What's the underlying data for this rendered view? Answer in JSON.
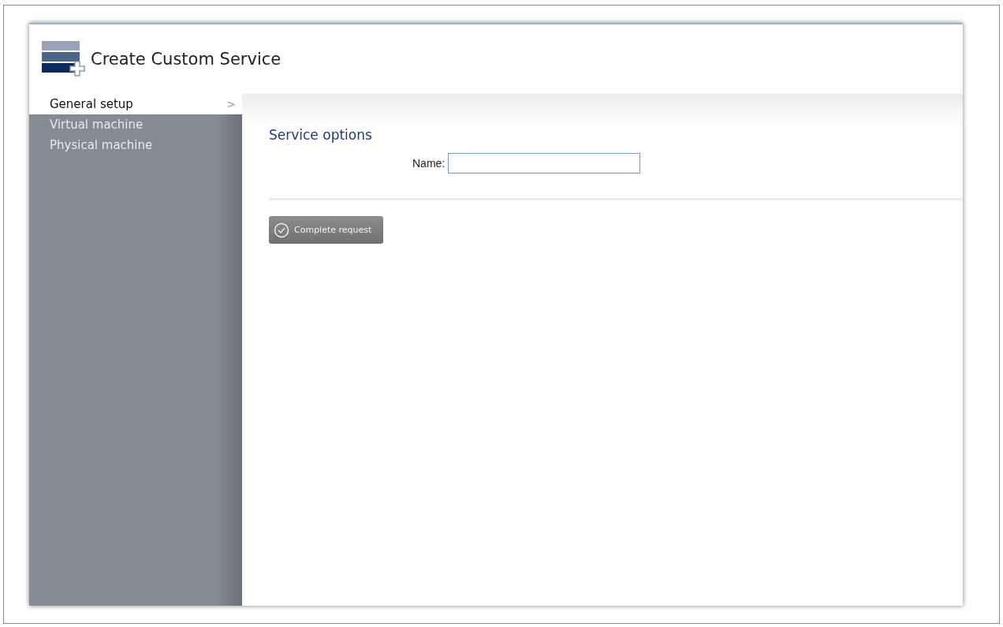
{
  "window": {
    "title": "Create Custom Service"
  },
  "sidebar": {
    "items": [
      {
        "label": "General setup",
        "selected": true,
        "chevron": ">"
      },
      {
        "label": "Virtual machine",
        "selected": false
      },
      {
        "label": "Physical machine",
        "selected": false
      }
    ]
  },
  "section": {
    "title": "Service options",
    "fields": [
      {
        "label": "Name:"
      }
    ]
  },
  "buttons": [
    {
      "label": "Complete request"
    }
  ]
}
